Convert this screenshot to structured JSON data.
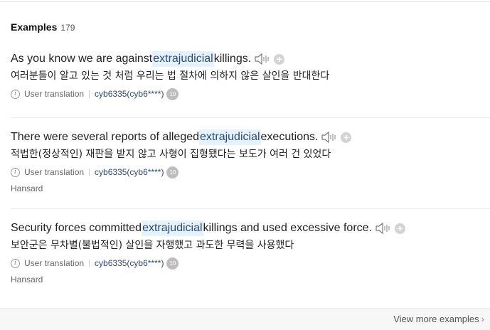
{
  "header": {
    "title": "Examples",
    "count": "179"
  },
  "examples": [
    {
      "pre": "As you know we are against ",
      "highlight": "extrajudicial",
      "post": " killings.",
      "translation": "여러분들이 알고 있는 것 처럼 우리는 법 절차에 의하지 않은 살인을 반대한다",
      "meta_label": "User translation",
      "user": "cyb6335(cyb6****)",
      "badge": "10",
      "source": ""
    },
    {
      "pre": "There were several reports of alleged ",
      "highlight": "extrajudicial",
      "post": " executions.",
      "translation": "적법한(정상적인) 재판을 받지 않고 사형이 집형됐다는 보도가 여러 건 있었다",
      "meta_label": "User translation",
      "user": "cyb6335(cyb6****)",
      "badge": "10",
      "source": "Hansard"
    },
    {
      "pre": "Security forces committed ",
      "highlight": "extrajudicial",
      "post": " killings and used excessive force.",
      "translation": "보안군은 무차별(불법적인) 살인을 자행했고 과도한 무력을 사용했다",
      "meta_label": "User translation",
      "user": "cyb6335(cyb6****)",
      "badge": "10",
      "source": "Hansard"
    }
  ],
  "footer": {
    "view_more": "View more examples"
  },
  "icons": {
    "speaker": "speaker-icon",
    "add": "plus-circle-icon",
    "info": "info-icon",
    "chevron": "chevron-right-icon"
  },
  "colors": {
    "highlight_bg": "#e6f2fb",
    "user_link": "#2d4a74",
    "badge_bg": "#bdbdbd"
  }
}
